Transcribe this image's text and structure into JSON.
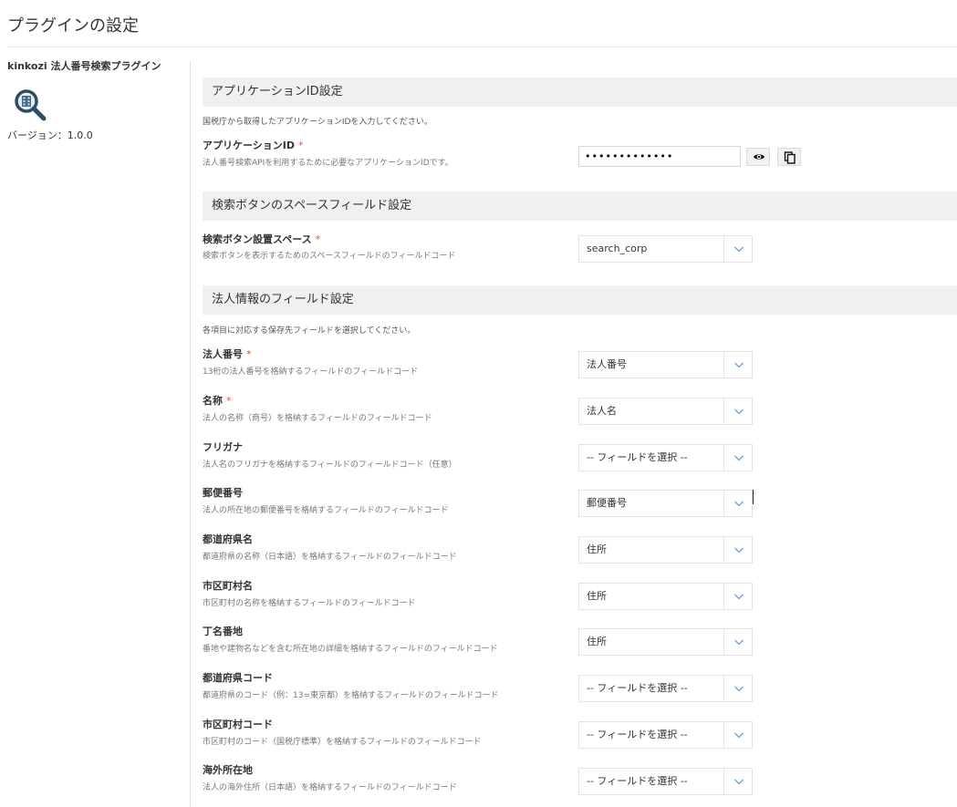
{
  "page": {
    "title": "プラグインの設定"
  },
  "sidebar": {
    "plugin_name": "kinkozi 法人番号検索プラグイン",
    "version": "バージョン：1.0.0",
    "icon": "magnifier-building-icon"
  },
  "sections": {
    "app_id": {
      "title": "アプリケーションID設定",
      "description": "国税庁から取得したアプリケーションIDを入力してください。",
      "field": {
        "label": "アプリケーションID",
        "required_mark": "*",
        "help": "法人番号検索APIを利用するために必要なアプリケーションIDです。",
        "value": "•••••••••••••",
        "show_icon": "eye-icon",
        "copy_icon": "copy-icon"
      }
    },
    "search_button": {
      "title": "検索ボタンのスペースフィールド設定",
      "field": {
        "label": "検索ボタン設置スペース",
        "required_mark": "*",
        "help": "検索ボタンを表示するためのスペースフィールドのフィールドコード",
        "value": "search_corp"
      }
    },
    "corp_info": {
      "title": "法人情報のフィールド設定",
      "description": "各項目に対応する保存先フィールドを選択してください。",
      "fields": [
        {
          "label": "法人番号",
          "required_mark": "*",
          "help": "13桁の法人番号を格納するフィールドのフィールドコード",
          "value": "法人番号"
        },
        {
          "label": "名称",
          "required_mark": "*",
          "help": "法人の名称（商号）を格納するフィールドのフィールドコード",
          "value": "法人名"
        },
        {
          "label": "フリガナ",
          "required_mark": "",
          "help": "法人名のフリガナを格納するフィールドのフィールドコード（任意）",
          "value": "-- フィールドを選択 --"
        },
        {
          "label": "郵便番号",
          "required_mark": "",
          "help": "法人の所在地の郵便番号を格納するフィールドのフィールドコード",
          "value": "郵便番号"
        },
        {
          "label": "都道府県名",
          "required_mark": "",
          "help": "都道府県の名称（日本語）を格納するフィールドのフィールドコード",
          "value": "住所"
        },
        {
          "label": "市区町村名",
          "required_mark": "",
          "help": "市区町村の名称を格納するフィールドのフィールドコード",
          "value": "住所"
        },
        {
          "label": "丁名番地",
          "required_mark": "",
          "help": "番地や建物名などを含む所在地の詳細を格納するフィールドのフィールドコード",
          "value": "住所"
        },
        {
          "label": "都道府県コード",
          "required_mark": "",
          "help": "都道府県のコード（例：13=東京都）を格納するフィールドのフィールドコード",
          "value": "-- フィールドを選択 --"
        },
        {
          "label": "市区町村コード",
          "required_mark": "",
          "help": "市区町村のコード（国税庁標準）を格納するフィールドのフィールドコード",
          "value": "-- フィールドを選択 --"
        },
        {
          "label": "海外所在地",
          "required_mark": "",
          "help": "法人の海外住所（日本語）を格納するフィールドのフィールドコード",
          "value": "-- フィールドを選択 --"
        }
      ]
    }
  },
  "icons": {
    "select_chevron": "chevron-down-icon"
  },
  "colors": {
    "required": "#e74c3c",
    "header_bg": "#f0f0f0",
    "border": "#e3e3e3"
  }
}
